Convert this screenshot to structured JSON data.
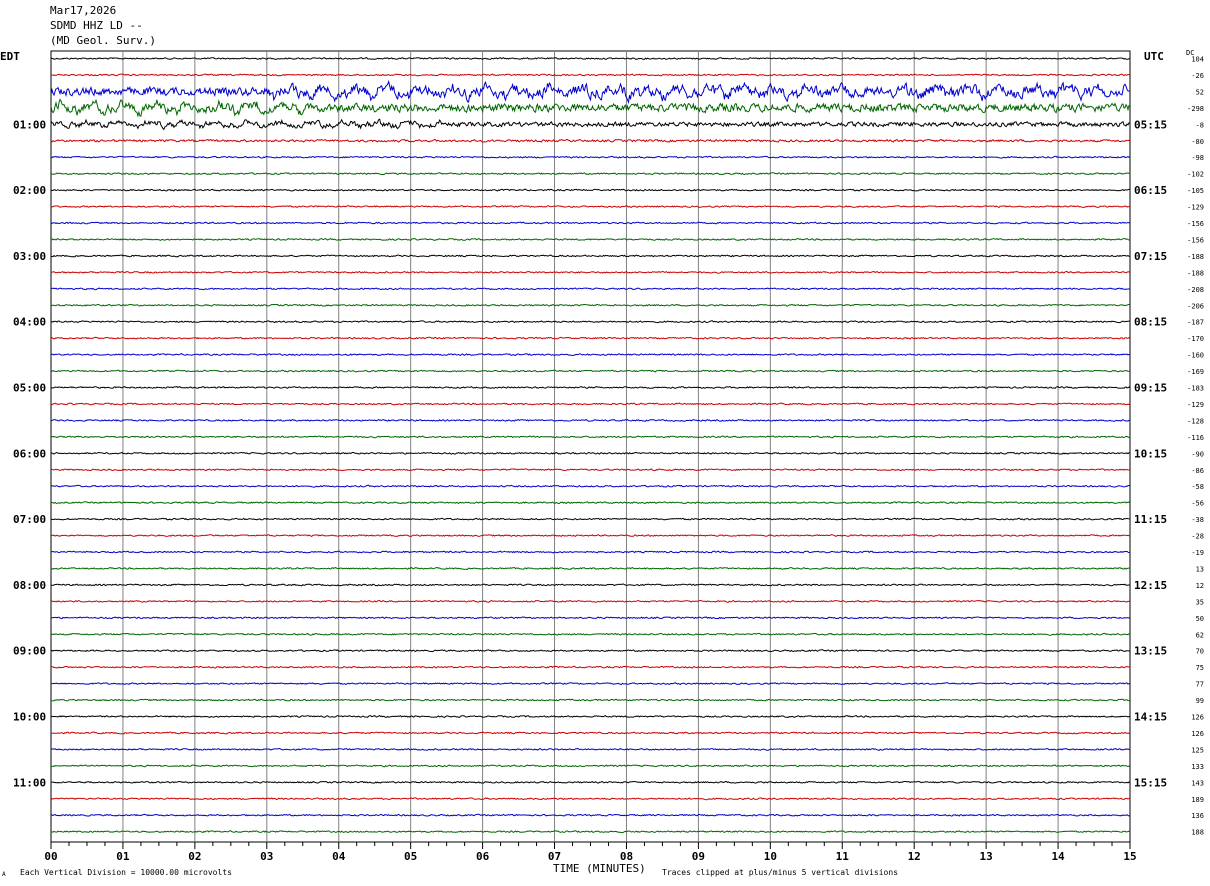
{
  "header": {
    "date": "Mar17,2026",
    "station": "SDMD HHZ LD --",
    "agency": "(MD Geol. Surv.)"
  },
  "left_axis_title": "EDT",
  "right_axis_title": "UTC",
  "dc_title": "DC",
  "x_axis": {
    "label": "TIME (MINUTES)",
    "ticks": [
      "00",
      "01",
      "02",
      "03",
      "04",
      "05",
      "06",
      "07",
      "08",
      "09",
      "10",
      "11",
      "12",
      "13",
      "14",
      "15"
    ]
  },
  "footer": {
    "left": "Each Vertical Division = 10000.00 microvolts",
    "right": "Traces clipped at plus/minus 5 vertical divisions",
    "corner_mark": "A"
  },
  "colors": {
    "trace_cycle": [
      "#000000",
      "#cc0000",
      "#0000cc",
      "#006600"
    ],
    "grid": "#808080"
  },
  "chart_data": {
    "type": "line",
    "description_type": "helicorder",
    "minutes_per_line": 15,
    "x_range": [
      0,
      15
    ],
    "trace_count": 48,
    "left_hour_labels": [
      {
        "trace": 4,
        "label": "01:00"
      },
      {
        "trace": 8,
        "label": "02:00"
      },
      {
        "trace": 12,
        "label": "03:00"
      },
      {
        "trace": 16,
        "label": "04:00"
      },
      {
        "trace": 20,
        "label": "05:00"
      },
      {
        "trace": 24,
        "label": "06:00"
      },
      {
        "trace": 28,
        "label": "07:00"
      },
      {
        "trace": 32,
        "label": "08:00"
      },
      {
        "trace": 36,
        "label": "09:00"
      },
      {
        "trace": 40,
        "label": "10:00"
      },
      {
        "trace": 44,
        "label": "11:00"
      }
    ],
    "right_hour_labels": [
      {
        "trace": 4,
        "label": "05:15"
      },
      {
        "trace": 8,
        "label": "06:15"
      },
      {
        "trace": 12,
        "label": "07:15"
      },
      {
        "trace": 16,
        "label": "08:15"
      },
      {
        "trace": 20,
        "label": "09:15"
      },
      {
        "trace": 24,
        "label": "10:15"
      },
      {
        "trace": 28,
        "label": "11:15"
      },
      {
        "trace": 32,
        "label": "12:15"
      },
      {
        "trace": 36,
        "label": "13:15"
      },
      {
        "trace": 40,
        "label": "14:15"
      },
      {
        "trace": 44,
        "label": "15:15"
      }
    ],
    "dc_offsets": [
      "104",
      "-26",
      "52",
      "-298",
      "-8",
      "-80",
      "-98",
      "-102",
      "-105",
      "-129",
      "-156",
      "-156",
      "-188",
      "-188",
      "-208",
      "-206",
      "-187",
      "-170",
      "-160",
      "-169",
      "-183",
      "-129",
      "-128",
      "-116",
      "-90",
      "-86",
      "-58",
      "-56",
      "-38",
      "-28",
      "-19",
      "13",
      "12",
      "35",
      "50",
      "62",
      "70",
      "75",
      "77",
      "99",
      "126",
      "126",
      "125",
      "133",
      "143",
      "189",
      "136",
      "188"
    ],
    "trace_amplitude": [
      0.1,
      0.1,
      0.55,
      0.55,
      0.3,
      0.15,
      0.1,
      0.1,
      0.1,
      0.1,
      0.1,
      0.1,
      0.1,
      0.1,
      0.1,
      0.1,
      0.1,
      0.1,
      0.1,
      0.1,
      0.1,
      0.1,
      0.1,
      0.1,
      0.1,
      0.1,
      0.1,
      0.1,
      0.1,
      0.1,
      0.1,
      0.1,
      0.1,
      0.1,
      0.1,
      0.1,
      0.1,
      0.1,
      0.1,
      0.1,
      0.1,
      0.1,
      0.1,
      0.1,
      0.1,
      0.1,
      0.1,
      0.1
    ],
    "events": [
      {
        "trace": 2,
        "start_minute": 2.9,
        "end_minute": 15,
        "amplitude": 0.7
      },
      {
        "trace": 3,
        "start_minute": 0,
        "end_minute": 3.5,
        "amplitude": 0.6
      },
      {
        "trace": 4,
        "start_minute": 0,
        "end_minute": 5.5,
        "amplitude": 0.35
      }
    ]
  }
}
